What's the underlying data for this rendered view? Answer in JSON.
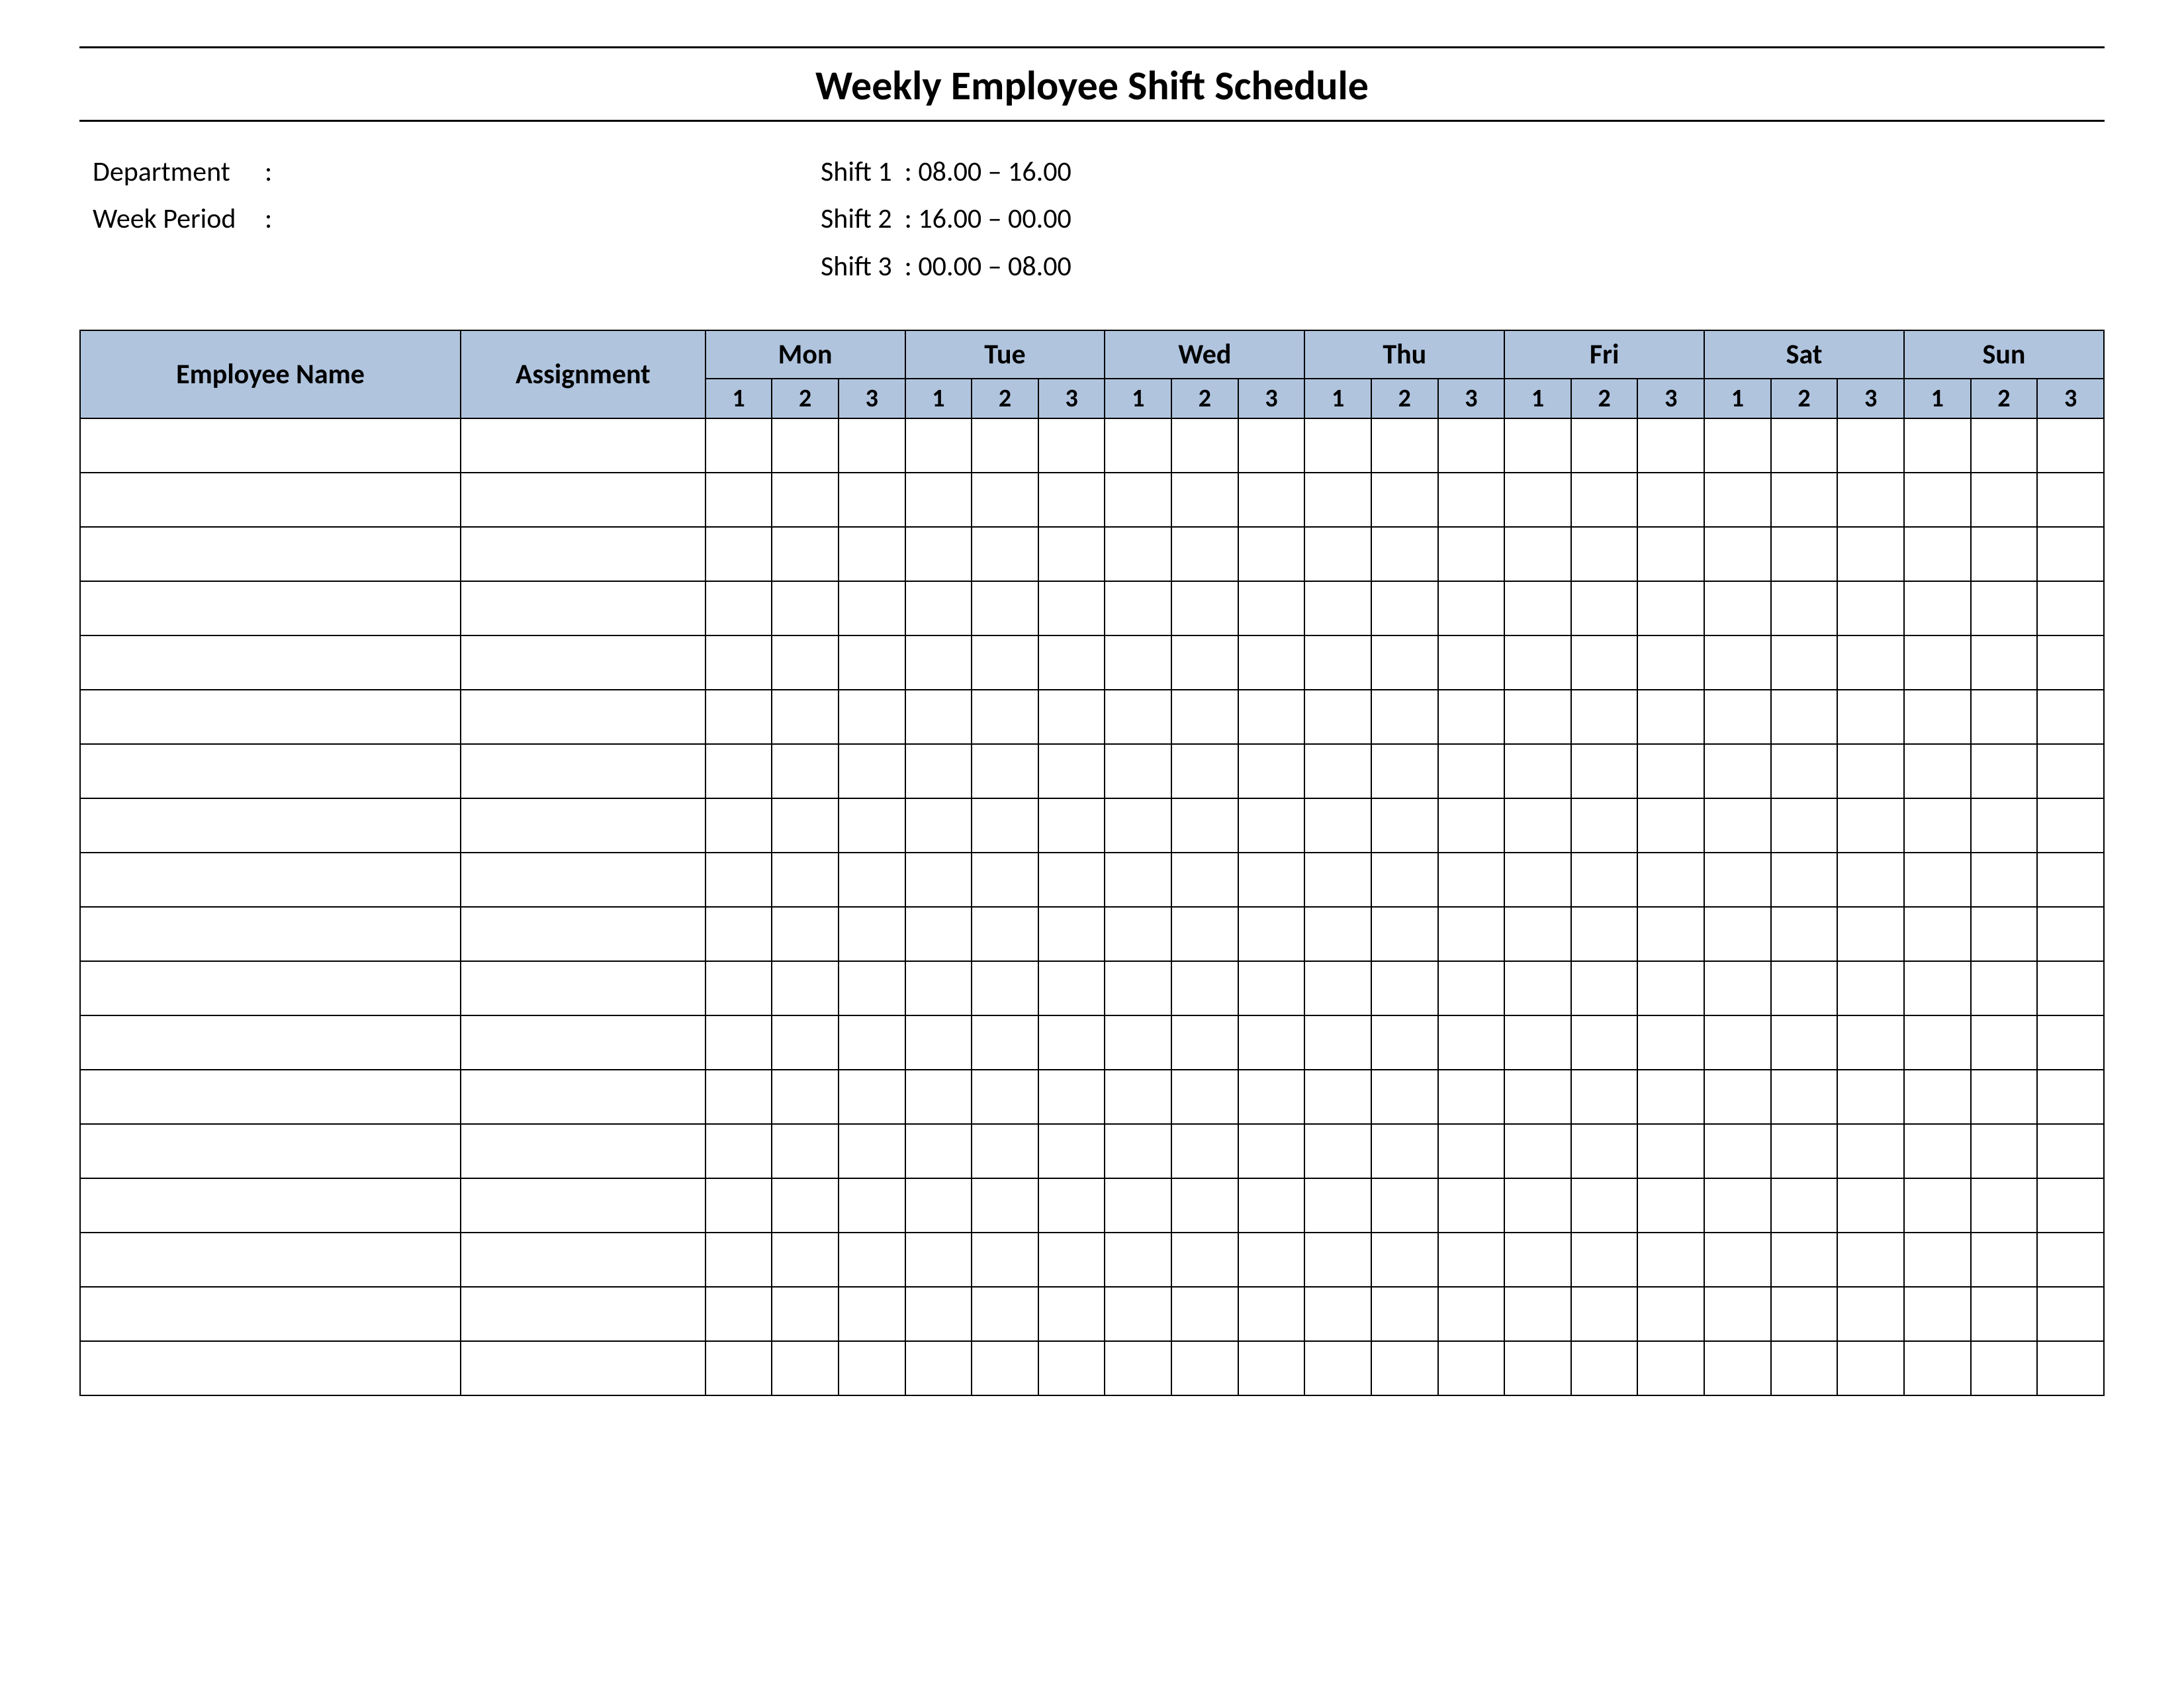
{
  "title": "Weekly Employee Shift Schedule",
  "meta": {
    "department_label": "Department",
    "department_value": "",
    "week_period_label": "Week  Period",
    "week_period_value": "",
    "shift1_label": "Shift 1",
    "shift1_value": "08.00  – 16.00",
    "shift2_label": "Shift 2",
    "shift2_value": "16.00  – 00.00",
    "shift3_label": "Shift 3",
    "shift3_value": "00.00  – 08.00"
  },
  "headers": {
    "employee_name": "Employee Name",
    "assignment": "Assignment",
    "days": [
      "Mon",
      "Tue",
      "Wed",
      "Thu",
      "Fri",
      "Sat",
      "Sun"
    ],
    "shifts": [
      "1",
      "2",
      "3"
    ]
  },
  "rows": [
    {
      "name": "",
      "assignment": "",
      "cells": [
        "",
        "",
        "",
        "",
        "",
        "",
        "",
        "",
        "",
        "",
        "",
        "",
        "",
        "",
        "",
        "",
        "",
        "",
        "",
        "",
        ""
      ]
    },
    {
      "name": "",
      "assignment": "",
      "cells": [
        "",
        "",
        "",
        "",
        "",
        "",
        "",
        "",
        "",
        "",
        "",
        "",
        "",
        "",
        "",
        "",
        "",
        "",
        "",
        "",
        ""
      ]
    },
    {
      "name": "",
      "assignment": "",
      "cells": [
        "",
        "",
        "",
        "",
        "",
        "",
        "",
        "",
        "",
        "",
        "",
        "",
        "",
        "",
        "",
        "",
        "",
        "",
        "",
        "",
        ""
      ]
    },
    {
      "name": "",
      "assignment": "",
      "cells": [
        "",
        "",
        "",
        "",
        "",
        "",
        "",
        "",
        "",
        "",
        "",
        "",
        "",
        "",
        "",
        "",
        "",
        "",
        "",
        "",
        ""
      ]
    },
    {
      "name": "",
      "assignment": "",
      "cells": [
        "",
        "",
        "",
        "",
        "",
        "",
        "",
        "",
        "",
        "",
        "",
        "",
        "",
        "",
        "",
        "",
        "",
        "",
        "",
        "",
        ""
      ]
    },
    {
      "name": "",
      "assignment": "",
      "cells": [
        "",
        "",
        "",
        "",
        "",
        "",
        "",
        "",
        "",
        "",
        "",
        "",
        "",
        "",
        "",
        "",
        "",
        "",
        "",
        "",
        ""
      ]
    },
    {
      "name": "",
      "assignment": "",
      "cells": [
        "",
        "",
        "",
        "",
        "",
        "",
        "",
        "",
        "",
        "",
        "",
        "",
        "",
        "",
        "",
        "",
        "",
        "",
        "",
        "",
        ""
      ]
    },
    {
      "name": "",
      "assignment": "",
      "cells": [
        "",
        "",
        "",
        "",
        "",
        "",
        "",
        "",
        "",
        "",
        "",
        "",
        "",
        "",
        "",
        "",
        "",
        "",
        "",
        "",
        ""
      ]
    },
    {
      "name": "",
      "assignment": "",
      "cells": [
        "",
        "",
        "",
        "",
        "",
        "",
        "",
        "",
        "",
        "",
        "",
        "",
        "",
        "",
        "",
        "",
        "",
        "",
        "",
        "",
        ""
      ]
    },
    {
      "name": "",
      "assignment": "",
      "cells": [
        "",
        "",
        "",
        "",
        "",
        "",
        "",
        "",
        "",
        "",
        "",
        "",
        "",
        "",
        "",
        "",
        "",
        "",
        "",
        "",
        ""
      ]
    },
    {
      "name": "",
      "assignment": "",
      "cells": [
        "",
        "",
        "",
        "",
        "",
        "",
        "",
        "",
        "",
        "",
        "",
        "",
        "",
        "",
        "",
        "",
        "",
        "",
        "",
        "",
        ""
      ]
    },
    {
      "name": "",
      "assignment": "",
      "cells": [
        "",
        "",
        "",
        "",
        "",
        "",
        "",
        "",
        "",
        "",
        "",
        "",
        "",
        "",
        "",
        "",
        "",
        "",
        "",
        "",
        ""
      ]
    },
    {
      "name": "",
      "assignment": "",
      "cells": [
        "",
        "",
        "",
        "",
        "",
        "",
        "",
        "",
        "",
        "",
        "",
        "",
        "",
        "",
        "",
        "",
        "",
        "",
        "",
        "",
        ""
      ]
    },
    {
      "name": "",
      "assignment": "",
      "cells": [
        "",
        "",
        "",
        "",
        "",
        "",
        "",
        "",
        "",
        "",
        "",
        "",
        "",
        "",
        "",
        "",
        "",
        "",
        "",
        "",
        ""
      ]
    },
    {
      "name": "",
      "assignment": "",
      "cells": [
        "",
        "",
        "",
        "",
        "",
        "",
        "",
        "",
        "",
        "",
        "",
        "",
        "",
        "",
        "",
        "",
        "",
        "",
        "",
        "",
        ""
      ]
    },
    {
      "name": "",
      "assignment": "",
      "cells": [
        "",
        "",
        "",
        "",
        "",
        "",
        "",
        "",
        "",
        "",
        "",
        "",
        "",
        "",
        "",
        "",
        "",
        "",
        "",
        "",
        ""
      ]
    },
    {
      "name": "",
      "assignment": "",
      "cells": [
        "",
        "",
        "",
        "",
        "",
        "",
        "",
        "",
        "",
        "",
        "",
        "",
        "",
        "",
        "",
        "",
        "",
        "",
        "",
        "",
        ""
      ]
    },
    {
      "name": "",
      "assignment": "",
      "cells": [
        "",
        "",
        "",
        "",
        "",
        "",
        "",
        "",
        "",
        "",
        "",
        "",
        "",
        "",
        "",
        "",
        "",
        "",
        "",
        "",
        ""
      ]
    }
  ]
}
